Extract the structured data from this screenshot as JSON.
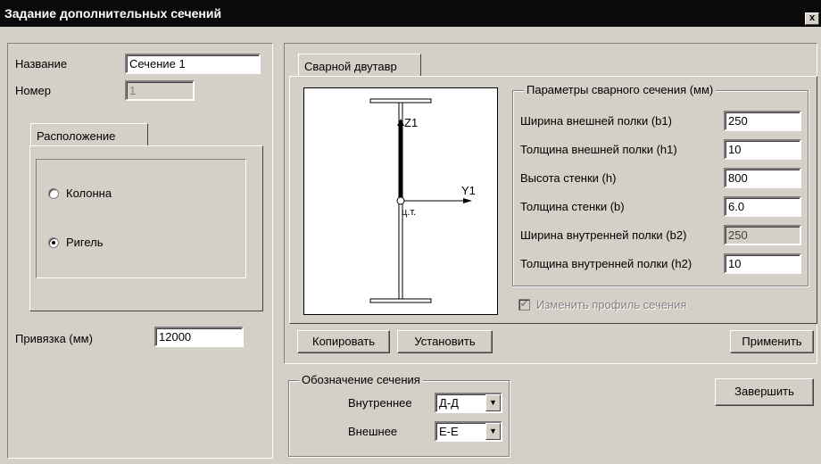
{
  "window": {
    "title": "Задание дополнительных сечений",
    "close_label": "x"
  },
  "left": {
    "name_label": "Название",
    "name_value": "Сечение 1",
    "number_label": "Номер",
    "number_value": "1",
    "location_tab": "Расположение",
    "radio_column": "Колонна",
    "radio_beam": "Ригель",
    "selected": "beam",
    "offset_label": "Привязка (мм)",
    "offset_value": "12000"
  },
  "main_tab": "Сварной двутавр",
  "drawing": {
    "z_label": "Z1",
    "y_label": "Y1",
    "center_label": "ц.т."
  },
  "params": {
    "title": "Параметры сварного сечения (мм)",
    "rows": [
      {
        "label": "Ширина внешней полки (b1)",
        "value": "250",
        "enabled": true
      },
      {
        "label": "Толщина внешней полки (h1)",
        "value": "10",
        "enabled": true
      },
      {
        "label": "Высота стенки  (h)",
        "value": "800",
        "enabled": true
      },
      {
        "label": "Толщина стенки (b)",
        "value": "6.0",
        "enabled": true
      },
      {
        "label": "Ширина внутренней полки (b2)",
        "value": "250",
        "enabled": false
      },
      {
        "label": "Толщина внутренней полки (h2)",
        "value": "10",
        "enabled": true
      }
    ],
    "change_profile": "Изменить профиль сечения",
    "change_profile_checked": true
  },
  "buttons": {
    "copy": "Копировать",
    "set": "Установить",
    "apply": "Применить",
    "finish": "Завершить"
  },
  "designation": {
    "title": "Обозначение сечения",
    "inner_label": "Внутреннее",
    "inner_value": "Д-Д",
    "outer_label": "Внешнее",
    "outer_value": "Е-Е"
  }
}
